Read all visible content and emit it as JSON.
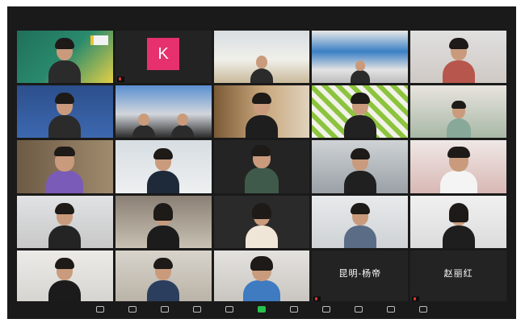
{
  "meeting": {
    "participants": [
      {
        "id": "p1",
        "name": "",
        "center_text": ""
      },
      {
        "id": "p2",
        "name": "",
        "avatar_letter": "K"
      },
      {
        "id": "p3",
        "name": ""
      },
      {
        "id": "p4",
        "name": ""
      },
      {
        "id": "p5",
        "name": ""
      },
      {
        "id": "p6",
        "name": ""
      },
      {
        "id": "p7",
        "name": ""
      },
      {
        "id": "p8",
        "name": ""
      },
      {
        "id": "p9",
        "name": ""
      },
      {
        "id": "p10",
        "name": ""
      },
      {
        "id": "p11",
        "name": ""
      },
      {
        "id": "p12",
        "name": ""
      },
      {
        "id": "p13",
        "name": ""
      },
      {
        "id": "p14",
        "name": ""
      },
      {
        "id": "p15",
        "name": ""
      },
      {
        "id": "p16",
        "name": ""
      },
      {
        "id": "p17",
        "name": ""
      },
      {
        "id": "p18",
        "name": ""
      },
      {
        "id": "p19",
        "name": ""
      },
      {
        "id": "p20",
        "name": ""
      },
      {
        "id": "p21",
        "name": ""
      },
      {
        "id": "p22",
        "name": ""
      },
      {
        "id": "p23",
        "name": ""
      },
      {
        "id": "p24",
        "name": "",
        "center_text": "昆明-杨帝"
      },
      {
        "id": "p25",
        "name": "",
        "center_text": "赵丽红"
      }
    ]
  },
  "toolbar": {
    "items": [
      {
        "label": ""
      },
      {
        "label": ""
      },
      {
        "label": ""
      },
      {
        "label": ""
      },
      {
        "label": ""
      },
      {
        "label": ""
      },
      {
        "label": ""
      },
      {
        "label": ""
      },
      {
        "label": ""
      },
      {
        "label": ""
      },
      {
        "label": ""
      }
    ]
  },
  "colors": {
    "window_bg": "#1a1a1a",
    "tile_bg": "#232323",
    "active_speaker_border": "#c7d63a",
    "avatar_k": "#e6316e",
    "share_green": "#27c24c",
    "muted_red": "#d43a2f"
  },
  "icons": {
    "toolbar": [
      "audio-icon",
      "video-icon",
      "security-icon",
      "participants-icon",
      "chat-icon",
      "share-screen-icon",
      "polls-icon",
      "record-icon",
      "breakout-rooms-icon",
      "reactions-icon",
      "more-icon"
    ]
  }
}
